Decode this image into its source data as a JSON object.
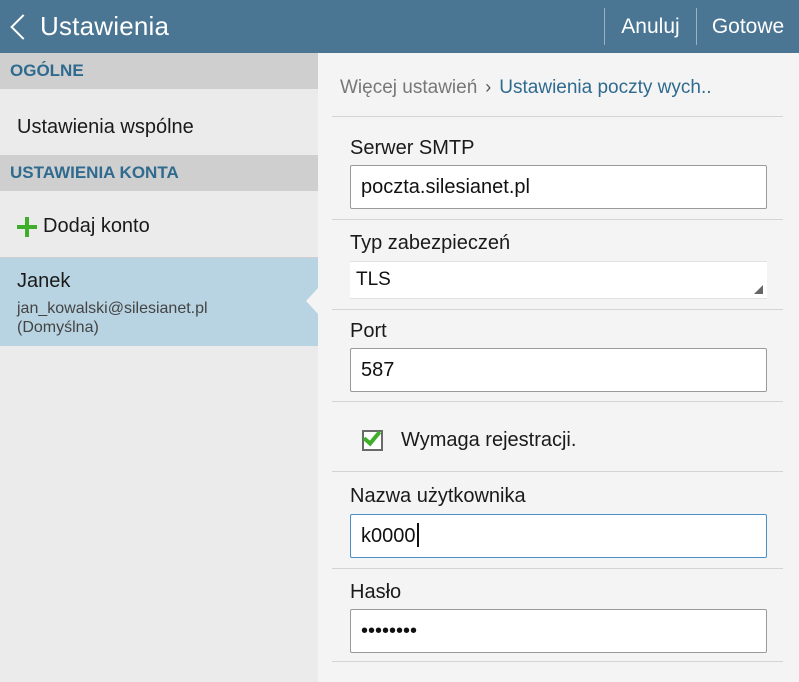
{
  "header": {
    "title": "Ustawienia",
    "cancel_label": "Anuluj",
    "done_label": "Gotowe"
  },
  "sidebar": {
    "general_header": "OGÓLNE",
    "common_settings": "Ustawienia wspólne",
    "account_header": "USTAWIENIA KONTA",
    "add_account": "Dodaj konto",
    "account": {
      "name": "Janek",
      "email": "jan_kowalski@silesianet.pl",
      "default_tag": "(Domyślna)"
    }
  },
  "breadcrumb": {
    "parent": "Więcej ustawień",
    "current": "Ustawienia poczty wych.."
  },
  "form": {
    "smtp_label": "Serwer SMTP",
    "smtp_value": "poczta.silesianet.pl",
    "security_label": "Typ zabezpieczeń",
    "security_value": "TLS",
    "port_label": "Port",
    "port_value": "587",
    "auth_label": "Wymaga rejestracji.",
    "auth_checked": true,
    "username_label": "Nazwa użytkownika",
    "username_value": "k0000",
    "password_label": "Hasło",
    "password_value": "••••••••"
  },
  "colors": {
    "header_bg": "#4a7593",
    "accent": "#2f6a8f",
    "check_green": "#3fae2a",
    "selected_bg": "#b8d3e2"
  }
}
